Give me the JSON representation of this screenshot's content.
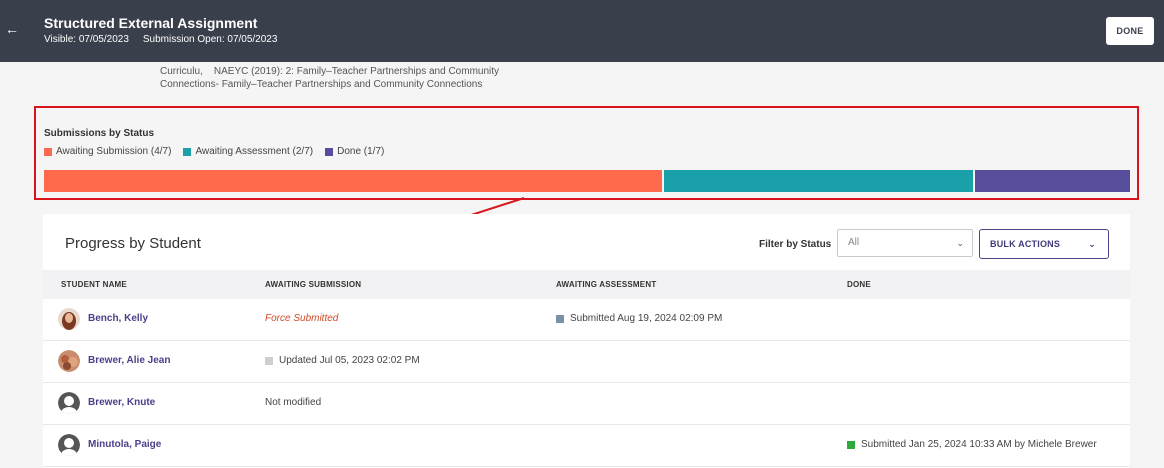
{
  "header": {
    "back_icon": "arrow-left-icon",
    "title": "Structured External Assignment",
    "visible": "Visible: 07/05/2023",
    "submission_open": "Submission Open: 07/05/2023",
    "done_label": "DONE"
  },
  "standards": {
    "line1": "Curriculu,    NAEYC (2019): 2: Family–Teacher Partnerships and Community",
    "line2": "Connections- Family–Teacher Partnerships and Community Connections"
  },
  "status_chart": {
    "title": "Submissions by Status",
    "legend": [
      {
        "label": "Awaiting Submission (4/7)",
        "color": "#ff6a4d"
      },
      {
        "label": "Awaiting Assessment (2/7)",
        "color": "#1aa0a8"
      },
      {
        "label": "Done (1/7)",
        "color": "#564e9a"
      }
    ]
  },
  "chart_data": {
    "type": "bar",
    "title": "Submissions by Status",
    "categories": [
      "Awaiting Submission",
      "Awaiting Assessment",
      "Done"
    ],
    "values": [
      4,
      2,
      1
    ],
    "total": 7,
    "colors": [
      "#ff6a4d",
      "#1aa0a8",
      "#564e9a"
    ]
  },
  "progress": {
    "title": "Progress by Student",
    "filter_label": "Filter by Status",
    "filter_value": "All",
    "chevron_icon": "chevron-down-icon",
    "bulk_label": "BULK ACTIONS",
    "columns": [
      "STUDENT NAME",
      "AWAITING SUBMISSION",
      "AWAITING ASSESSMENT",
      "DONE"
    ],
    "rows": [
      {
        "name": "Bench, Kelly",
        "awaiting_submission": "Force Submitted",
        "awaiting_assessment": "Submitted Aug 19, 2024 02:09 PM",
        "done": ""
      },
      {
        "name": "Brewer, Alie Jean",
        "awaiting_submission": "Updated Jul 05, 2023 02:02 PM",
        "awaiting_assessment": "",
        "done": ""
      },
      {
        "name": "Brewer, Knute",
        "awaiting_submission": "Not modified",
        "awaiting_assessment": "",
        "done": ""
      },
      {
        "name": "Minutola, Paige",
        "awaiting_submission": "",
        "awaiting_assessment": "",
        "done": "Submitted Jan 25, 2024 10:33 AM by Michele Brewer"
      }
    ]
  },
  "colors": {
    "header_bg": "#3a3f4c",
    "highlight_border": "#d8141c",
    "student_link": "#4b3f8a",
    "done_square": "#2eaa3c",
    "assessment_square": "#7b8fa8",
    "updated_square": "#cfcfcf"
  }
}
